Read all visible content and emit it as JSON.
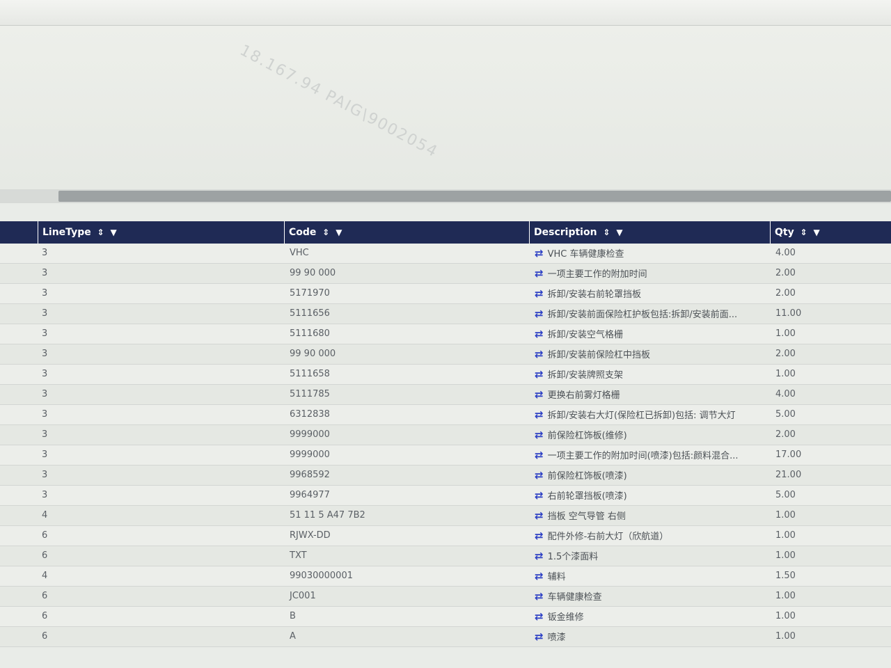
{
  "watermark": "18.167.94  PAIG\\9002054",
  "grid": {
    "columns": [
      {
        "key": "line_type",
        "label": "LineType"
      },
      {
        "key": "code",
        "label": "Code"
      },
      {
        "key": "description",
        "label": "Description"
      },
      {
        "key": "qty",
        "label": "Qty"
      }
    ],
    "sort_icon": "sort-icon",
    "filter_icon": "filter-icon",
    "row_icon": "swap-arrows-icon",
    "accent_color": "#1f2a55",
    "rows": [
      {
        "line_type": "3",
        "code": "VHC",
        "description": "VHC 车辆健康检查",
        "qty": "4.00"
      },
      {
        "line_type": "3",
        "code": "99 90 000",
        "description": "一项主要工作的附加时间",
        "qty": "2.00"
      },
      {
        "line_type": "3",
        "code": "5171970",
        "description": "拆卸/安装右前轮罩挡板",
        "qty": "2.00"
      },
      {
        "line_type": "3",
        "code": "5111656",
        "description": "拆卸/安装前面保险杠护板包括:拆卸/安装前面...",
        "qty": "11.00"
      },
      {
        "line_type": "3",
        "code": "5111680",
        "description": "拆卸/安装空气格栅",
        "qty": "1.00"
      },
      {
        "line_type": "3",
        "code": "99 90 000",
        "description": "拆卸/安装前保险杠中挡板",
        "qty": "2.00"
      },
      {
        "line_type": "3",
        "code": "5111658",
        "description": "拆卸/安装牌照支架",
        "qty": "1.00"
      },
      {
        "line_type": "3",
        "code": "5111785",
        "description": "更换右前雾灯格栅",
        "qty": "4.00"
      },
      {
        "line_type": "3",
        "code": "6312838",
        "description": "拆卸/安装右大灯(保险杠已拆卸)包括: 调节大灯",
        "qty": "5.00"
      },
      {
        "line_type": "3",
        "code": "9999000",
        "description": "前保险杠饰板(维修)",
        "qty": "2.00"
      },
      {
        "line_type": "3",
        "code": "9999000",
        "description": "一项主要工作的附加时间(喷漆)包括:颜料混合...",
        "qty": "17.00"
      },
      {
        "line_type": "3",
        "code": "9968592",
        "description": "前保险杠饰板(喷漆)",
        "qty": "21.00"
      },
      {
        "line_type": "3",
        "code": "9964977",
        "description": "右前轮罩挡板(喷漆)",
        "qty": "5.00"
      },
      {
        "line_type": "4",
        "code": "51 11 5 A47 7B2",
        "description": "挡板 空气导管 右侧",
        "qty": "1.00"
      },
      {
        "line_type": "6",
        "code": "RJWX-DD",
        "description": "配件外修-右前大灯（欣航道）",
        "qty": "1.00"
      },
      {
        "line_type": "6",
        "code": "TXT",
        "description": "1.5个漆面料",
        "qty": "1.00"
      },
      {
        "line_type": "4",
        "code": "99030000001",
        "description": "辅料",
        "qty": "1.50"
      },
      {
        "line_type": "6",
        "code": "JC001",
        "description": "车辆健康检查",
        "qty": "1.00"
      },
      {
        "line_type": "6",
        "code": "B",
        "description": "钣金维修",
        "qty": "1.00"
      },
      {
        "line_type": "6",
        "code": "A",
        "description": "喷漆",
        "qty": "1.00"
      }
    ]
  }
}
